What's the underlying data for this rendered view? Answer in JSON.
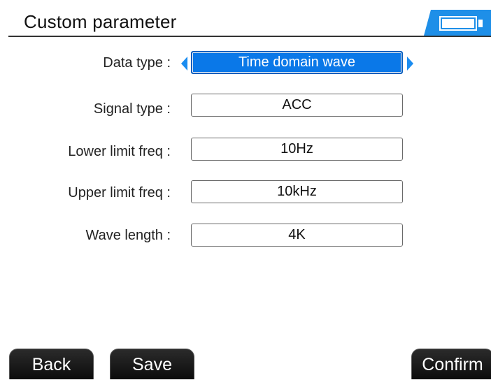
{
  "header": {
    "title": "Custom parameter",
    "battery_icon": "battery-icon",
    "accent_color": "#1e8fe8"
  },
  "form": {
    "rows": [
      {
        "label": "Data type :",
        "value": "Time domain wave",
        "selected": true
      },
      {
        "label": "Signal type :",
        "value": "ACC",
        "selected": false
      },
      {
        "label": "Lower limit freq :",
        "value": "10Hz",
        "selected": false
      },
      {
        "label": "Upper limit freq :",
        "value": "10kHz",
        "selected": false
      },
      {
        "label": "Wave length :",
        "value": "4K",
        "selected": false
      }
    ],
    "left_arrow_icon": "arrow-left-icon",
    "right_arrow_icon": "arrow-right-icon"
  },
  "softkeys": {
    "back": "Back",
    "save": "Save",
    "confirm": "Confirm"
  }
}
